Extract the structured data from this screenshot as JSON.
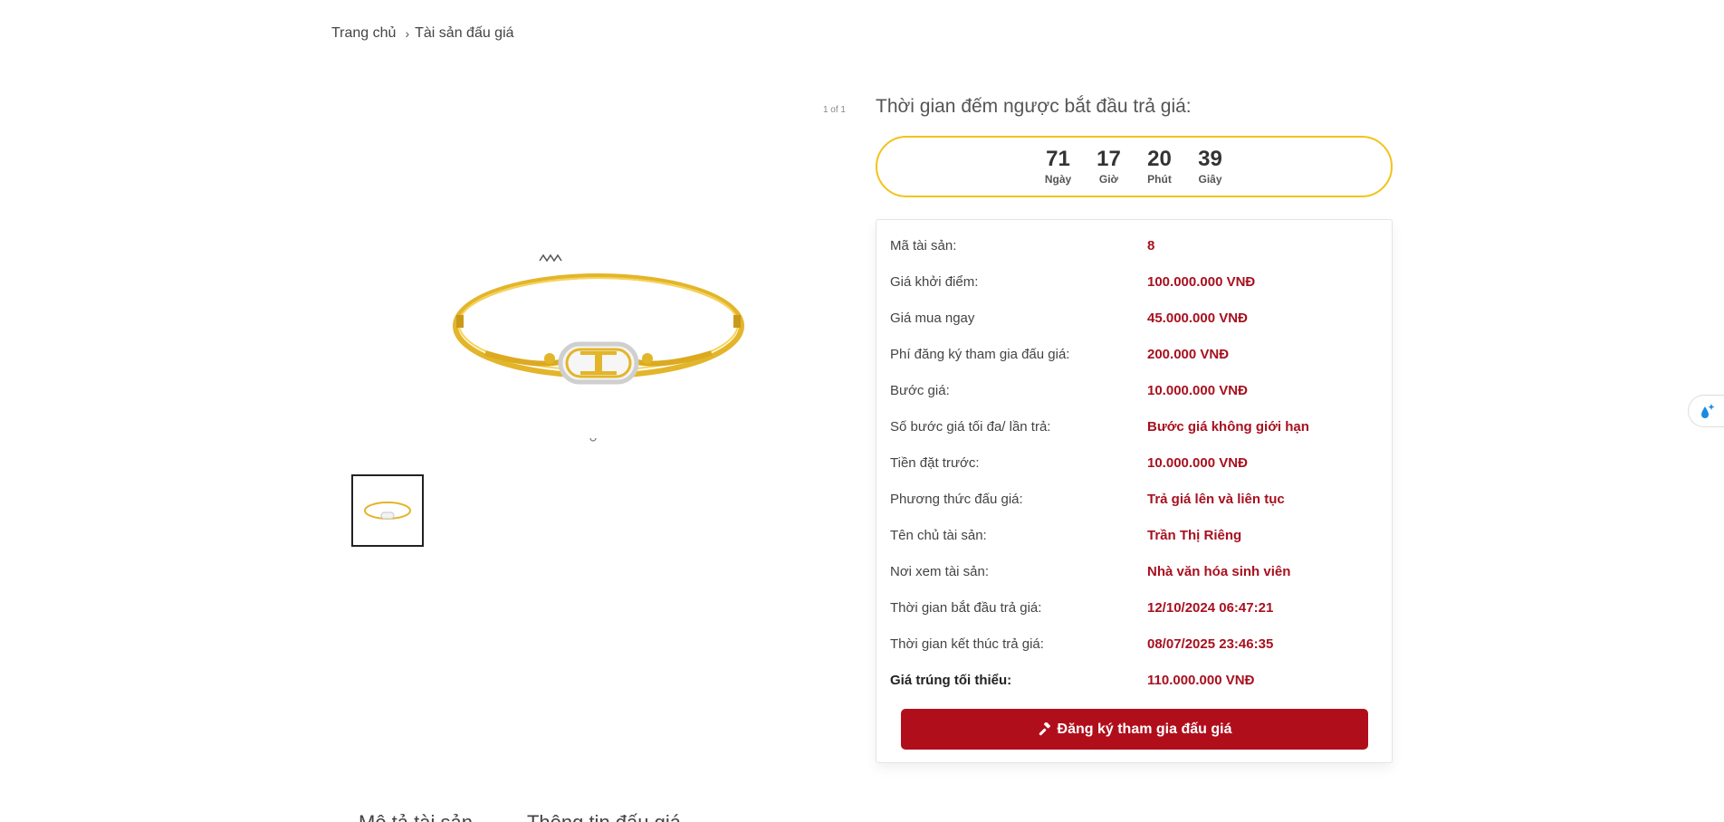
{
  "breadcrumb": {
    "home": "Trang chủ",
    "current": "Tài sản đấu giá"
  },
  "gallery": {
    "counter": "1 of 1",
    "image_alt": "gold-bangle-bracelet",
    "thumb_alt": "gold-bangle-thumbnail"
  },
  "countdown": {
    "title": "Thời gian đếm ngược bắt đầu trả giá:",
    "days": "71",
    "days_label": "Ngày",
    "hours": "17",
    "hours_label": "Giờ",
    "minutes": "20",
    "minutes_label": "Phút",
    "seconds": "39",
    "seconds_label": "Giây"
  },
  "details": [
    {
      "label": "Mã tài sản:",
      "value": "8"
    },
    {
      "label": "Giá khởi điểm:",
      "value": "100.000.000 VNĐ"
    },
    {
      "label": "Giá mua ngay",
      "value": "45.000.000 VNĐ"
    },
    {
      "label": "Phí đăng ký tham gia đấu giá:",
      "value": "200.000 VNĐ"
    },
    {
      "label": "Bước giá:",
      "value": "10.000.000 VNĐ"
    },
    {
      "label": "Số bước giá tối đa/ lần trả:",
      "value": "Bước giá không giới hạn"
    },
    {
      "label": "Tiền đặt trước:",
      "value": "10.000.000 VNĐ"
    },
    {
      "label": "Phương thức đấu giá:",
      "value": "Trả giá lên và liên tục"
    },
    {
      "label": "Tên chủ tài sản:",
      "value": "Trần Thị Riêng"
    },
    {
      "label": "Nơi xem tài sản:",
      "value": "Nhà văn hóa sinh viên"
    },
    {
      "label": "Thời gian bắt đầu trả giá:",
      "value": "12/10/2024 06:47:21"
    },
    {
      "label": "Thời gian kết thúc trả giá:",
      "value": "08/07/2025 23:46:35"
    },
    {
      "label": "Giá trúng tối thiểu:",
      "value": "110.000.000 VNĐ"
    }
  ],
  "register_button": {
    "label": "Đăng ký tham gia đấu giá",
    "icon": "gavel-icon"
  },
  "tabs": [
    "Mô tả tài sản",
    "Thông tin đấu giá"
  ],
  "colors": {
    "accent": "#b10e1c",
    "countdown_border": "#f2c31a",
    "value_text": "#a8101f"
  }
}
